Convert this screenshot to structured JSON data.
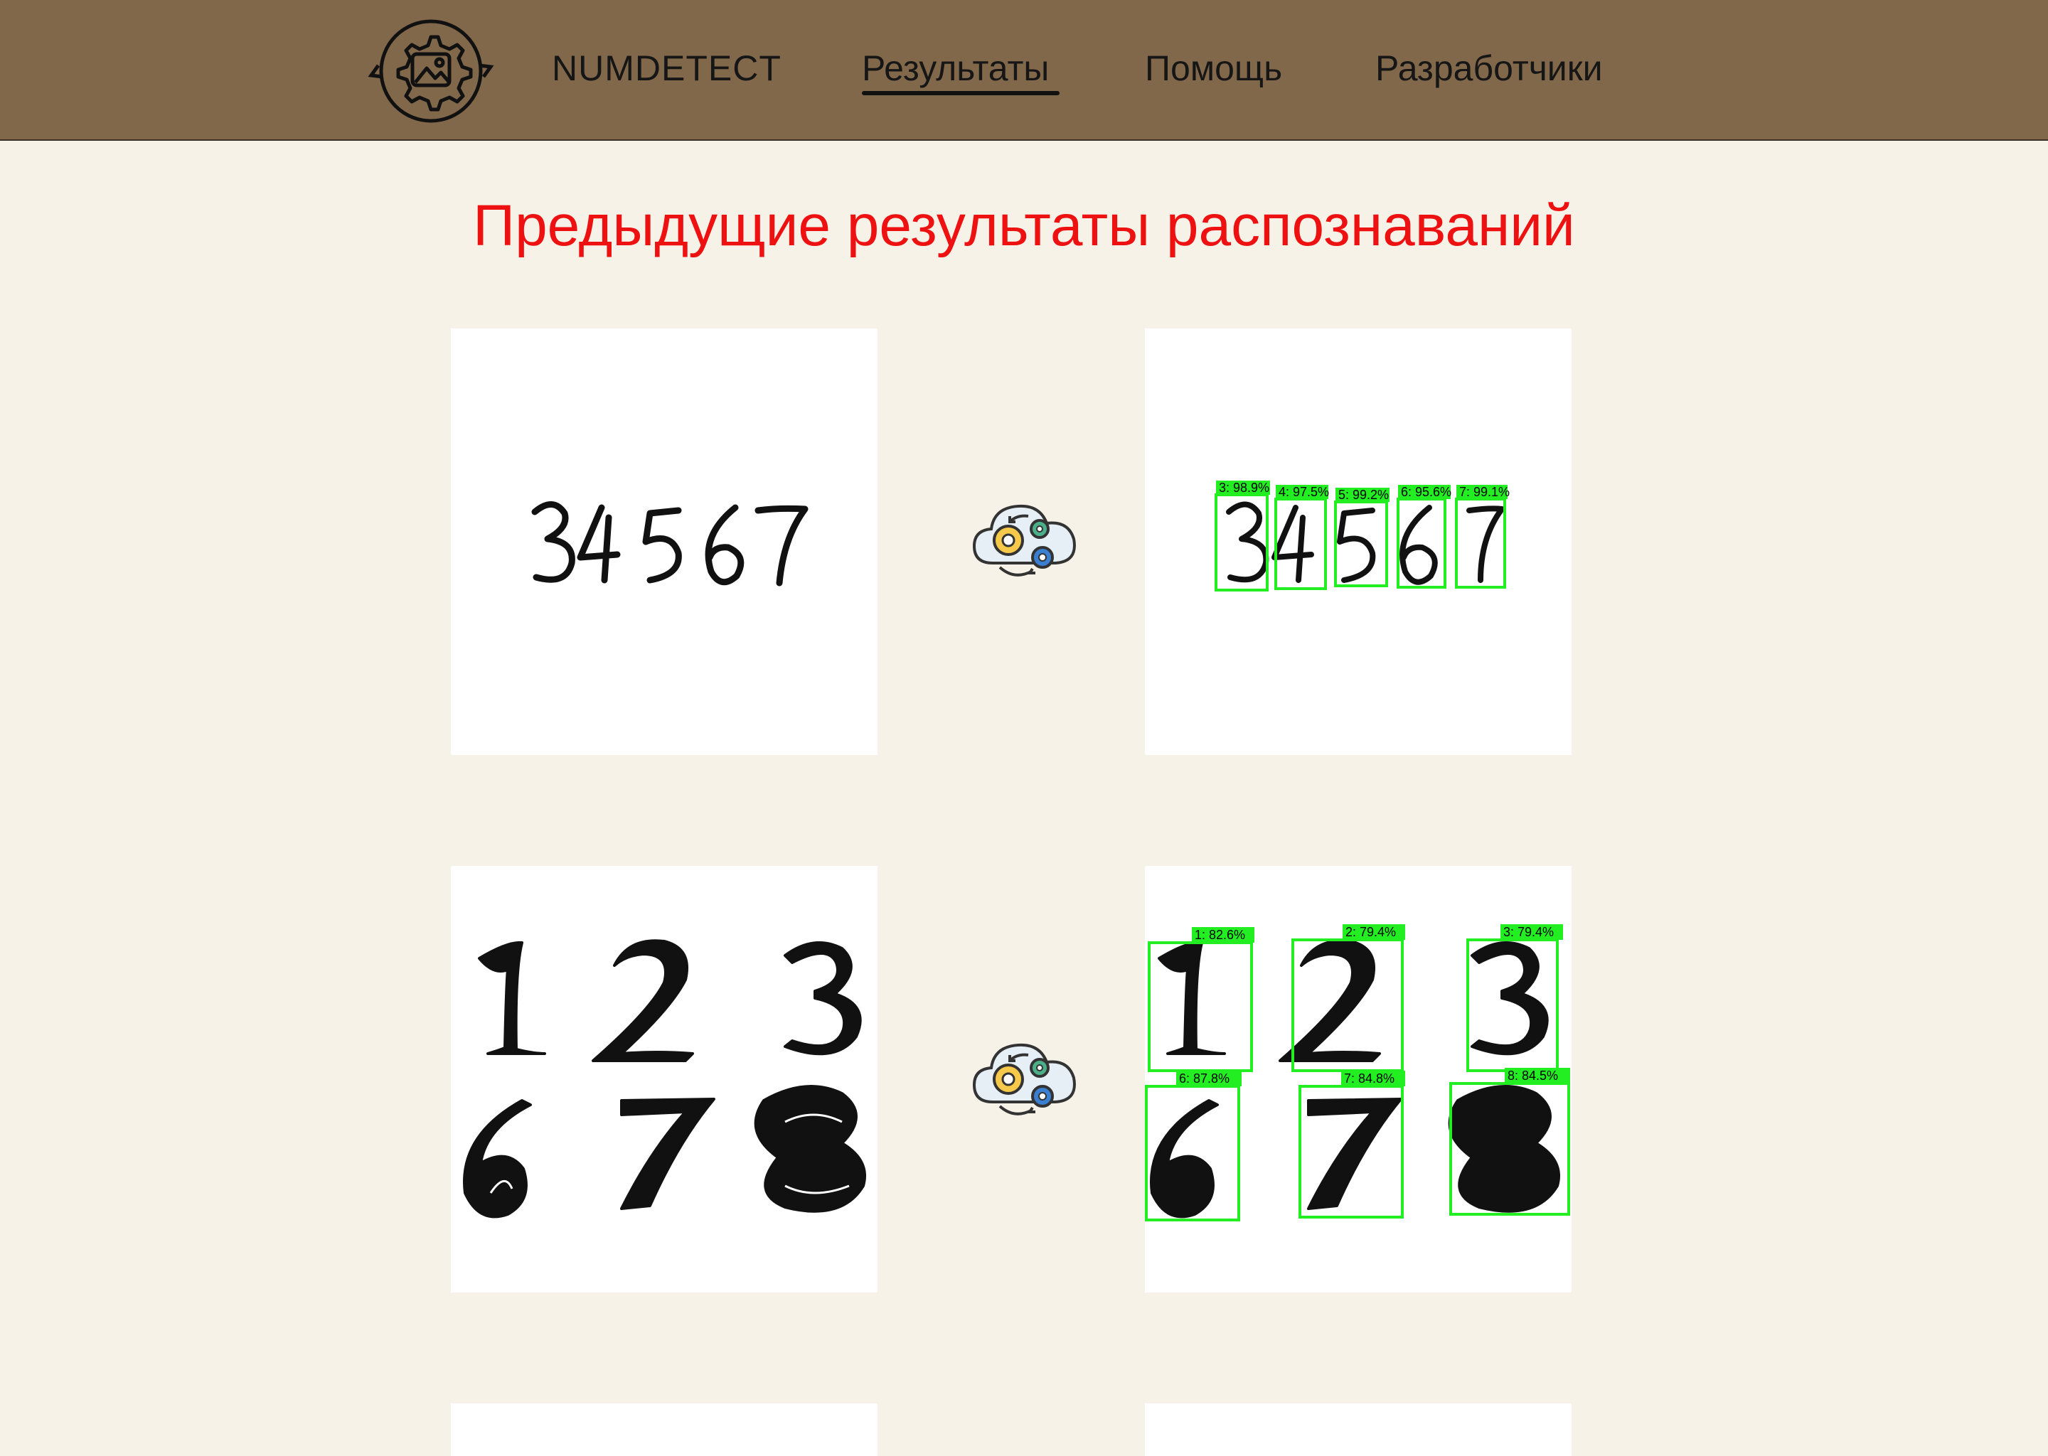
{
  "header": {
    "brand": "NUMDETECT",
    "nav": [
      {
        "label": "Результаты",
        "active": true
      },
      {
        "label": "Помощь",
        "active": false
      },
      {
        "label": "Разработчики",
        "active": false
      }
    ]
  },
  "page_title": "Предыдущие результаты распознаваний",
  "results": [
    {
      "input_digits": "34567",
      "detections": [
        {
          "label": "3: 98.9%"
        },
        {
          "label": "4: 97.5%"
        },
        {
          "label": "5: 99.2%"
        },
        {
          "label": "6: 95.6%"
        },
        {
          "label": "7: 99.1%"
        }
      ]
    },
    {
      "input_digits": "123678",
      "detections": [
        {
          "label": "1: 82.6%"
        },
        {
          "label": "2: 79.4%"
        },
        {
          "label": "3: 79.4%"
        },
        {
          "label": "6: 87.8%"
        },
        {
          "label": "7: 84.8%"
        },
        {
          "label": "8: 84.5%"
        }
      ]
    }
  ],
  "colors": {
    "header_bg": "#82684a",
    "page_bg": "#f6f2e8",
    "title": "#ee1111",
    "detection_box": "#22ee22"
  }
}
